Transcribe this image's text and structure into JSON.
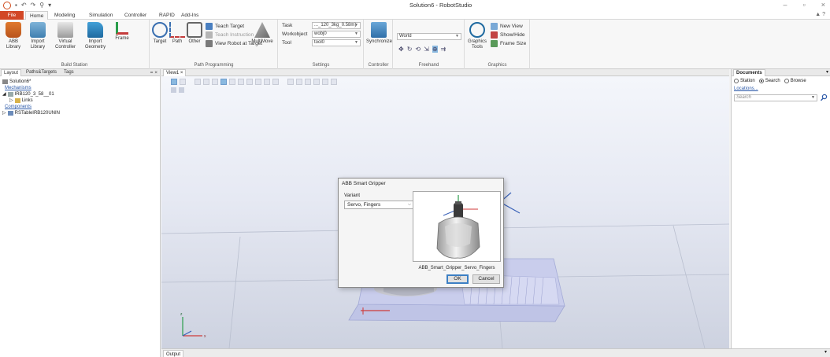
{
  "window": {
    "title": "Solution6 - RobotStudio"
  },
  "tabs": [
    "File",
    "Home",
    "Modeling",
    "Simulation",
    "Controller",
    "RAPID",
    "Add-Ins"
  ],
  "active_tab": "Home",
  "ribbon": {
    "build_station": {
      "label": "Build Station",
      "abb_library": [
        "ABB",
        "Library"
      ],
      "import_library": [
        "Import",
        "Library"
      ],
      "virtual_controller": [
        "Virtual",
        "Controller"
      ],
      "import_geometry": [
        "Import",
        "Geometry"
      ],
      "frame": "Frame"
    },
    "path_programming": {
      "label": "Path Programming",
      "target": "Target",
      "path": "Path",
      "other": "Other",
      "teach_target": "Teach Target",
      "teach_instruction": "Teach Instruction",
      "view_robot_at_target": "View Robot at Target",
      "multimove": "MultiMove"
    },
    "settings": {
      "label": "Settings",
      "task_label": "Task",
      "task_value": "..._120_3kg_0.58m)",
      "workobject_label": "Workobject",
      "workobject_value": "wobj0",
      "tool_label": "Tool",
      "tool_value": "tool0"
    },
    "controller": {
      "label": "Controller",
      "synchronize": "Synchronize"
    },
    "freehand": {
      "label": "Freehand",
      "reference": "World"
    },
    "graphics": {
      "label": "Graphics",
      "graphics_tools": [
        "Graphics",
        "Tools"
      ],
      "new_view": "New View",
      "show_hide": "Show/Hide",
      "frame_size": "Frame Size"
    }
  },
  "left_panel": {
    "tabs": [
      "Layout",
      "Paths&Targets",
      "Tags"
    ],
    "close": "= ×",
    "tree": {
      "station": "Solution6*",
      "mechanisms_header": "Mechanisms",
      "robot": "IRB120_3_58__01",
      "links": "Links",
      "components_header": "Components",
      "component": "RSTableIRB120UNIN"
    }
  },
  "view_tab": {
    "label": "View1 ×"
  },
  "right_panel": {
    "title": "Documents",
    "options": [
      "Station",
      "Search",
      "Browse"
    ],
    "selected_option": "Search",
    "locations": "Locations...",
    "search_placeholder": "Search"
  },
  "output_tab": "Output",
  "dialog": {
    "title": "ABB Smart Gripper",
    "variant_label": "Variant",
    "variant_value": "Servo, Fingers",
    "preview_caption": "ABB_Smart_Gripper_Servo_Fingers",
    "ok": "OK",
    "cancel": "Cancel"
  },
  "colors": {
    "file_tab": "#d24726",
    "accent": "#3c7fc4",
    "table_top": "#c9cdec"
  }
}
